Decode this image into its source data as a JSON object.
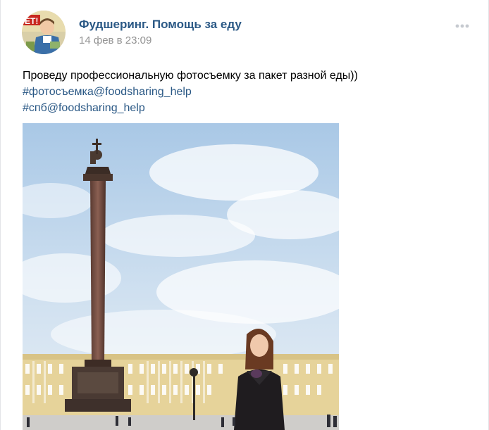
{
  "post": {
    "author_name": "Фудшеринг. Помощь за еду",
    "date": "14 фев в 23:09",
    "text_lines": [
      "Проведу профессиональную фотосъемку за пакет разной еды))"
    ],
    "hashtags": [
      "#фотосъемка@foodsharing_help",
      "#спб@foodsharing_help"
    ],
    "avatar_poster_text": "ЕТ!",
    "menu_icon": "more-dots-icon",
    "photo_icon": "photo-image"
  },
  "colors": {
    "link": "#2a5885",
    "date": "#939393",
    "menu_dots": "#c5c9cf"
  }
}
